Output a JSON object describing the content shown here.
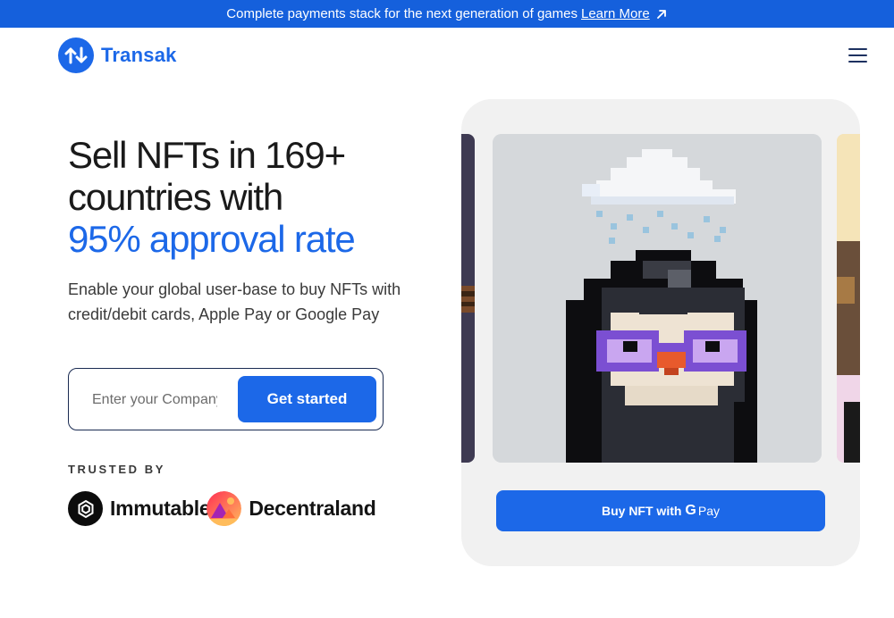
{
  "banner": {
    "text": "Complete payments stack for the next generation of games",
    "link_label": "Learn More",
    "link_icon": "arrow-up-right-icon"
  },
  "header": {
    "brand": "Transak",
    "logo_icon": "transak-arrows-icon",
    "menu_icon": "hamburger-menu-icon"
  },
  "hero": {
    "title_line1": "Sell NFTs in 169+",
    "title_line2": "countries with",
    "title_accent": "95% approval rate",
    "subtitle": "Enable your global user-base to buy NFTs with credit/debit cards, Apple Pay or Google Pay"
  },
  "signup": {
    "placeholder": "Enter your Company Name",
    "button_label": "Get started"
  },
  "trusted": {
    "heading": "TRUSTED BY",
    "partners": [
      "Immutable",
      "Decentraland"
    ]
  },
  "nft_card": {
    "buy_label": "Buy NFT with",
    "pay_g": "G",
    "pay_word": "Pay"
  },
  "colors": {
    "brand": "#1c68e8",
    "banner": "#1560dc",
    "dark_text": "#1a1a1a",
    "card_bg": "#f1f1f1"
  }
}
